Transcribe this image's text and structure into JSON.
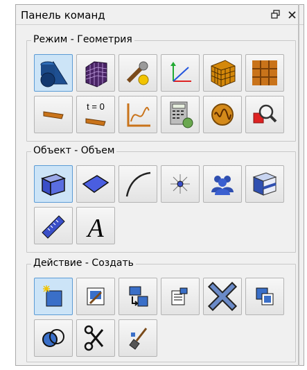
{
  "panel": {
    "title": "Панель команд",
    "restore_icon": "restore-icon",
    "close_icon": "close-icon"
  },
  "groups": {
    "mode": {
      "label": "Режим - Геометрия",
      "buttons": [
        "geometry-mode-icon",
        "mesh-mode-icon",
        "tools-mode-icon",
        "coordinate-system-icon",
        "mesh-cube-icon",
        "grid-icon",
        "initial-state-icon",
        "time-zero-icon",
        "graph-icon",
        "calculator-icon",
        "oscillation-icon",
        "inspect-icon"
      ]
    },
    "object": {
      "label": "Объект - Объем",
      "buttons": [
        "volume-icon",
        "surface-icon",
        "curve-icon",
        "point-icon",
        "group-icon",
        "solid-box-icon",
        "measure-icon",
        "text-icon"
      ]
    },
    "action": {
      "label": "Действие - Создать",
      "buttons": [
        "create-icon",
        "edit-icon",
        "copy-icon",
        "properties-icon",
        "delete-icon",
        "duplicate-icon",
        "intersect-icon",
        "cut-icon",
        "clean-icon"
      ]
    }
  },
  "text_glyphs": {
    "t_zero": "t = 0",
    "font_a": "A"
  },
  "colors": {
    "active_fill": "#cce4f7",
    "active_border": "#5b9bd5",
    "accent_blue": "#1f5fa8"
  }
}
